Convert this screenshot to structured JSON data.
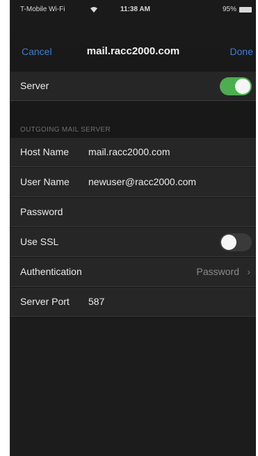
{
  "status_bar": {
    "carrier": "T-Mobile Wi-Fi",
    "time": "11:38 AM",
    "battery": "95%"
  },
  "nav": {
    "cancel_label": "Cancel",
    "title": "mail.racc2000.com",
    "done_label": "Done"
  },
  "server_row": {
    "label": "Server",
    "enabled": true
  },
  "section_header": "OUTGOING MAIL SERVER",
  "fields": {
    "host_name_label": "Host Name",
    "host_name_value": "mail.racc2000.com",
    "user_name_label": "User Name",
    "user_name_value": "newuser@racc2000.com",
    "password_label": "Password",
    "use_ssl_label": "Use SSL",
    "use_ssl_enabled": false,
    "authentication_label": "Authentication",
    "authentication_value": "Password",
    "server_port_label": "Server Port",
    "server_port_value": "587"
  },
  "icons": {
    "wifi": "wifi-icon",
    "battery": "battery-icon",
    "chevron": "chevron-right-icon"
  },
  "colors": {
    "accent": "#3d7fcf",
    "toggle_on": "#4cae4f"
  }
}
